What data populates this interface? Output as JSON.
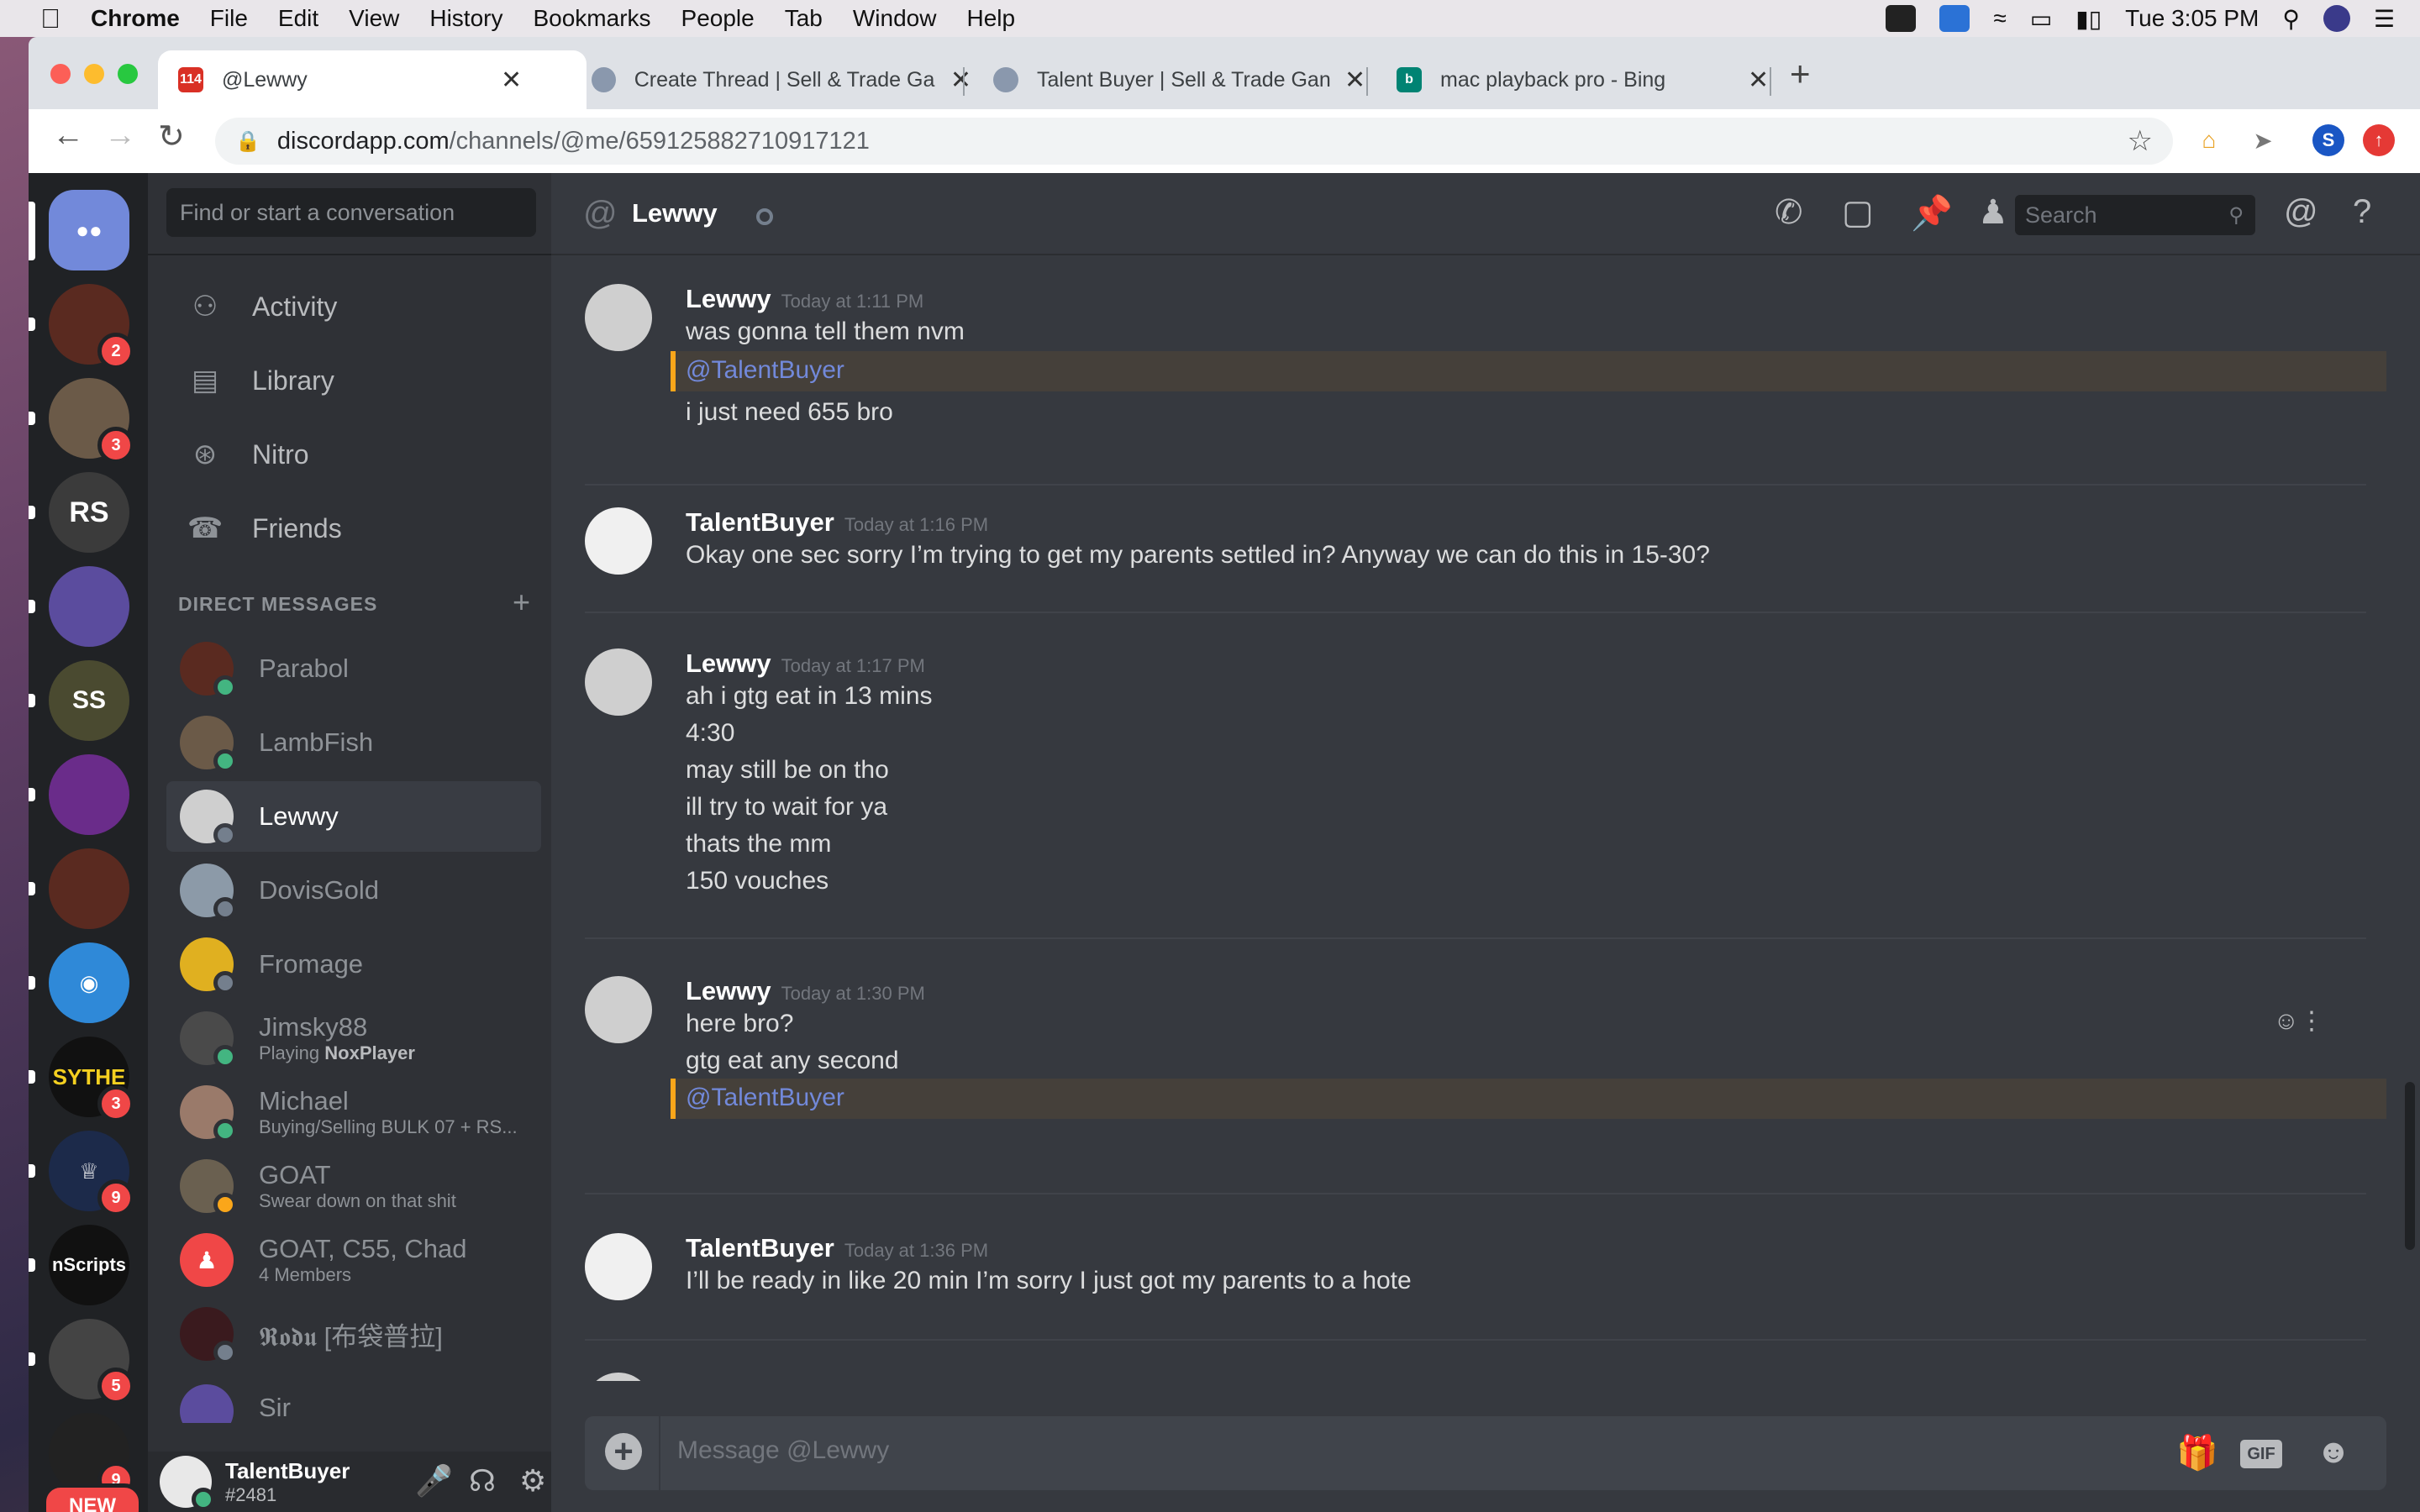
{
  "menubar": {
    "app": "Chrome",
    "items": [
      "File",
      "Edit",
      "View",
      "History",
      "Bookmarks",
      "People",
      "Tab",
      "Window",
      "Help"
    ],
    "clock": "Tue 3:05 PM"
  },
  "browser": {
    "tabs": [
      {
        "title": "@Lewwy",
        "favicon_badge": "114"
      },
      {
        "title": "Create Thread | Sell & Trade Ga"
      },
      {
        "title": "Talent Buyer | Sell & Trade Gan"
      },
      {
        "title": "mac playback pro - Bing"
      }
    ],
    "url_host": "discordapp.com",
    "url_path": "/channels/@me/659125882710917121",
    "profile_initial": "S"
  },
  "discord": {
    "guild_badges": [
      "2",
      "3",
      "3",
      "9",
      "5",
      "9"
    ],
    "guild_labels": [
      "SYTHE",
      "nScripts"
    ],
    "new_badge": "NEW",
    "dm_search_placeholder": "Find or start a conversation",
    "nav": [
      "Activity",
      "Library",
      "Nitro",
      "Friends"
    ],
    "dm_header": "DIRECT MESSAGES",
    "dms": [
      {
        "name": "Parabol",
        "sub": ""
      },
      {
        "name": "LambFish",
        "sub": ""
      },
      {
        "name": "Lewwy",
        "sub": ""
      },
      {
        "name": "DovisGold",
        "sub": ""
      },
      {
        "name": "Fromage",
        "sub": ""
      },
      {
        "name": "Jimsky88",
        "sub_prefix": "Playing ",
        "sub_bold": "NoxPlayer"
      },
      {
        "name": "Michael",
        "sub": "Buying/Selling BULK 07 + RS..."
      },
      {
        "name": "GOAT",
        "sub": "Swear down on that shit"
      },
      {
        "name": "GOAT, C55, Chad",
        "sub": "4 Members"
      },
      {
        "name": "𝕽𝖔𝖉𝖚 [布袋普拉]",
        "sub": ""
      },
      {
        "name": "Sir",
        "sub": ""
      }
    ],
    "user": {
      "name": "TalentBuyer",
      "tag": "#2481"
    },
    "channel_title": "Lewwy",
    "header_search": "Search",
    "messages": [
      {
        "author": "Lewwy",
        "time": "Today at 1:11 PM",
        "lines": [
          "was gonna tell them nvm"
        ],
        "mention": "@TalentBuyer",
        "after": [
          "i just need 655 bro"
        ]
      },
      {
        "author": "TalentBuyer",
        "time": "Today at 1:16 PM",
        "lines": [
          "Okay one sec sorry I’m trying to get my parents settled in? Anyway we can do this in 15-30?"
        ]
      },
      {
        "author": "Lewwy",
        "time": "Today at 1:17 PM",
        "lines": [
          "ah i gtg eat in 13 mins",
          "4:30",
          "may still be on tho",
          "ill try to wait for ya",
          "thats the mm",
          "150 vouches"
        ]
      },
      {
        "author": "Lewwy",
        "time": "Today at 1:30 PM",
        "lines": [
          "here bro?",
          "gtg eat any second"
        ],
        "mention": "@TalentBuyer"
      },
      {
        "author": "TalentBuyer",
        "time": "Today at 1:36 PM",
        "lines": [
          "I’ll be ready in like 20 min I’m sorry I just got my parents to a hote"
        ]
      }
    ],
    "composer_placeholder": "Message @Lewwy",
    "gif_label": "GIF"
  }
}
